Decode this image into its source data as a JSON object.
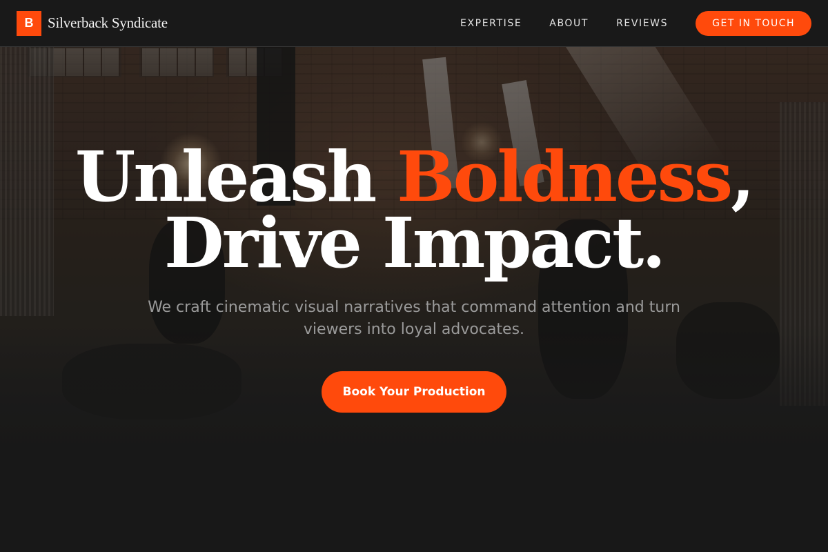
{
  "brand": {
    "mark": "B",
    "name": "Silverback Syndicate"
  },
  "nav": {
    "items": [
      {
        "label": "EXPERTISE"
      },
      {
        "label": "ABOUT"
      },
      {
        "label": "REVIEWS"
      }
    ],
    "cta_label": "GET IN TOUCH"
  },
  "hero": {
    "headline": {
      "part1": "Unleash ",
      "accent": "Boldness",
      "part2": ",",
      "line2": "Drive Impact."
    },
    "subtitle": "We craft cinematic visual narratives that command attention and turn viewers into loyal advocates.",
    "cta_label": "Book Your Production"
  },
  "colors": {
    "accent": "#ff4a0c",
    "background": "#1c1c1c",
    "header_bg": "#1a1a1a",
    "headline_text": "#ffffff",
    "subtitle_text": "#9a9a9a"
  }
}
